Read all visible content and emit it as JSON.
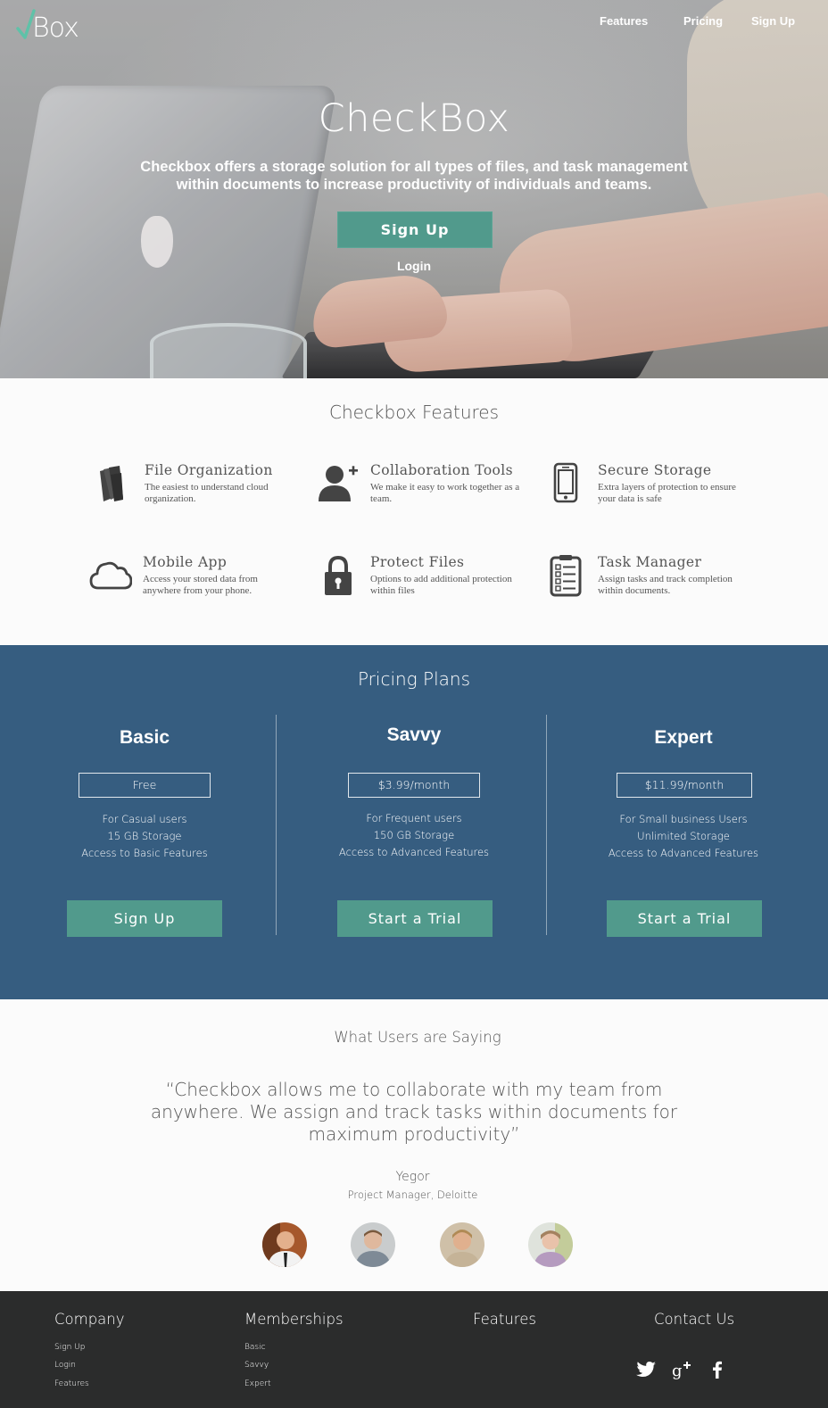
{
  "colors": {
    "accent_green": "#519a8c",
    "pricing_blue": "#365d80",
    "footer_dark": "#2b2c2c",
    "page_bg": "#fbfbfb"
  },
  "header": {
    "logo_text": "Box",
    "logo_icon": "checkmark-icon",
    "nav": [
      "Features",
      "Pricing",
      "Sign Up"
    ]
  },
  "hero": {
    "title": "CheckBox",
    "subtitle": "Checkbox offers a storage solution for all types of files, and task management within documents to increase productivity of individuals and teams.",
    "signup_label": "Sign Up",
    "login_label": "Login"
  },
  "features": {
    "title": "Checkbox Features",
    "items": [
      {
        "icon": "folder-file-icon",
        "title": "File Organization",
        "desc": "The easiest to understand cloud organization."
      },
      {
        "icon": "add-user-icon",
        "title": "Collaboration Tools",
        "desc": "We make it easy to work together as a team."
      },
      {
        "icon": "phone-icon",
        "title": "Secure Storage",
        "desc": "Extra layers of protection to ensure your data is safe"
      },
      {
        "icon": "cloud-icon",
        "title": "Mobile App",
        "desc": "Access your stored data from anywhere from your phone."
      },
      {
        "icon": "lock-icon",
        "title": "Protect Files",
        "desc": "Options to add additional protection within files"
      },
      {
        "icon": "checklist-icon",
        "title": "Task Manager",
        "desc": "Assign tasks and track completion within documents."
      }
    ]
  },
  "pricing": {
    "title": "Pricing Plans",
    "plans": [
      {
        "name": "Basic",
        "price": "Free",
        "features": [
          "For Casual users",
          "15 GB Storage",
          "Access to Basic Features"
        ],
        "button": "Sign Up"
      },
      {
        "name": "Savvy",
        "price": "$3.99/month",
        "features": [
          "For Frequent users",
          "150 GB Storage",
          "Access to Advanced Features"
        ],
        "button": "Start a Trial"
      },
      {
        "name": "Expert",
        "price": "$11.99/month",
        "features": [
          "For Small business Users",
          "Unlimited Storage",
          "Access to Advanced Features"
        ],
        "button": "Start a Trial"
      }
    ]
  },
  "testimonials": {
    "title": "What Users are Saying",
    "quote": "“Checkbox allows me to collaborate with my team from anywhere. We assign and track tasks within documents for maximum productivity”",
    "author": "Yegor",
    "role": "Project Manager, Deloitte"
  },
  "footer": {
    "columns": [
      {
        "title": "Company",
        "links": [
          "Sign Up",
          "Login",
          "Features"
        ]
      },
      {
        "title": "Memberships",
        "links": [
          "Basic",
          "Savvy",
          "Expert"
        ]
      },
      {
        "title": "Features",
        "links": []
      },
      {
        "title": "Contact Us",
        "links": []
      }
    ],
    "social": [
      "twitter-icon",
      "google-plus-icon",
      "facebook-icon"
    ]
  }
}
